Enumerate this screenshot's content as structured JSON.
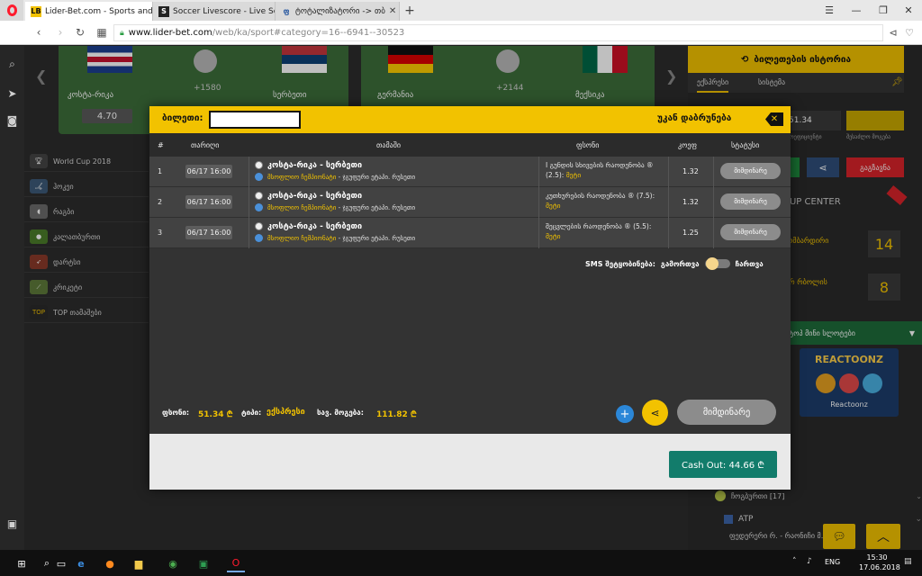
{
  "browser": {
    "tabs": [
      {
        "title": "Lider-Bet.com - Sports and",
        "favicon": "LB"
      },
      {
        "title": "Soccer Livescore - Live Sco",
        "favicon": "S"
      },
      {
        "title": "ტოტალიზატორი -> თბ",
        "favicon": "ფ"
      }
    ],
    "url_host": "www.lider-bet.com",
    "url_path": "/web/ka/sport#category=16--6941--30523"
  },
  "background": {
    "matches": [
      {
        "home": "კოსტა-რიკა",
        "away": "სერბეთი",
        "odds_count": "+1580",
        "odd": "4.70"
      },
      {
        "home": "გერმანია",
        "away": "მექსიკა",
        "odds_count": "+2144"
      }
    ],
    "sports": [
      {
        "label": "World Cup 2018"
      },
      {
        "label": "ჰოკეი"
      },
      {
        "label": "რაგბი"
      },
      {
        "label": "კალათბურთი"
      },
      {
        "label": "დარტსი"
      },
      {
        "label": "კრიკეტი"
      },
      {
        "label": "TOP თამაშები",
        "icon_text": "TOP"
      }
    ],
    "right_panel": {
      "history_button": "ბილეთების ისტორია",
      "tab_active": "ექსპრესი",
      "tab_other": "სისტემა",
      "balance": "51.34",
      "label_coef": "კოეფიციენტი",
      "label_win": "შესაძლო მოგება",
      "red_button": "გაგზავნა",
      "cup_center": "CUP CENTER",
      "row1": "ბომბარდირი",
      "num1": "14",
      "row2": "ორ რბოლის",
      "num2": "8",
      "slots_header": "ტოპ მინი სლოტები",
      "slot_title": "REACTOONZ",
      "slot_name": "Reactoonz",
      "tennis": "ჩოგბურთი [17]",
      "atp": "ATP",
      "match_row": "ფედერერი რ. - რაონიჩი მ."
    }
  },
  "modal": {
    "ticket_label": "ბილეთი:",
    "back_label": "უკან დაბრუნება",
    "headers": {
      "num": "#",
      "date": "თარიღი",
      "match": "თამაში",
      "bet": "ფსონი",
      "coef": "კოეფ",
      "status": "სტატუსი"
    },
    "rows": [
      {
        "num": "1",
        "date": "06/17 16:00",
        "event": "კოსტა-რიკა - სერბეთი",
        "league_a": "მსოფლიო ჩემპიონატი",
        "league_b": " - ჯგუფური ეტაპი. რუსეთი",
        "bet_a": "I გუნდის სხივების რაოდენობა ® (2.5):",
        "bet_b": " მეტი",
        "coef": "1.32",
        "status": "მიმდინარე"
      },
      {
        "num": "2",
        "date": "06/17 16:00",
        "event": "კოსტა-რიკა - სერბეთი",
        "league_a": "მსოფლიო ჩემპიონატი",
        "league_b": " - ჯგუფური ეტაპი. რუსეთი",
        "bet_a": "კუთხურების რაოდენობა ® (7.5):",
        "bet_b": " მეტი",
        "coef": "1.32",
        "status": "მიმდინარე"
      },
      {
        "num": "3",
        "date": "06/17 16:00",
        "event": "კოსტა-რიკა - სერბეთი",
        "league_a": "მსოფლიო ჩემპიონატი",
        "league_b": " - ჯგუფური ეტაპი. რუსეთი",
        "bet_a": "შეცვლების რაოდენობა ® (5.5):",
        "bet_b": " მეტი",
        "coef": "1.25",
        "status": "მიმდინარე"
      }
    ],
    "sms": {
      "label": "SMS შეტყობინება:",
      "off": "გამორთვა",
      "on": "ჩართვა"
    },
    "summary": {
      "stake_label": "ფსონი:",
      "stake_value": "51.34 ₾",
      "type_label": "ტიპი:",
      "type_value": "ექსპრესი",
      "win_label": "სავ. მოგება:",
      "win_value": "111.82 ₾"
    },
    "current_button": "მიმდინარე",
    "cashout": "Cash Out: 44.66 ₾"
  },
  "taskbar": {
    "lang": "ENG",
    "time": "15:30",
    "date": "17.06.2018"
  },
  "colors": {
    "accent": "#f2c200",
    "cashout": "#127c6b",
    "plus": "#2b87d8"
  }
}
